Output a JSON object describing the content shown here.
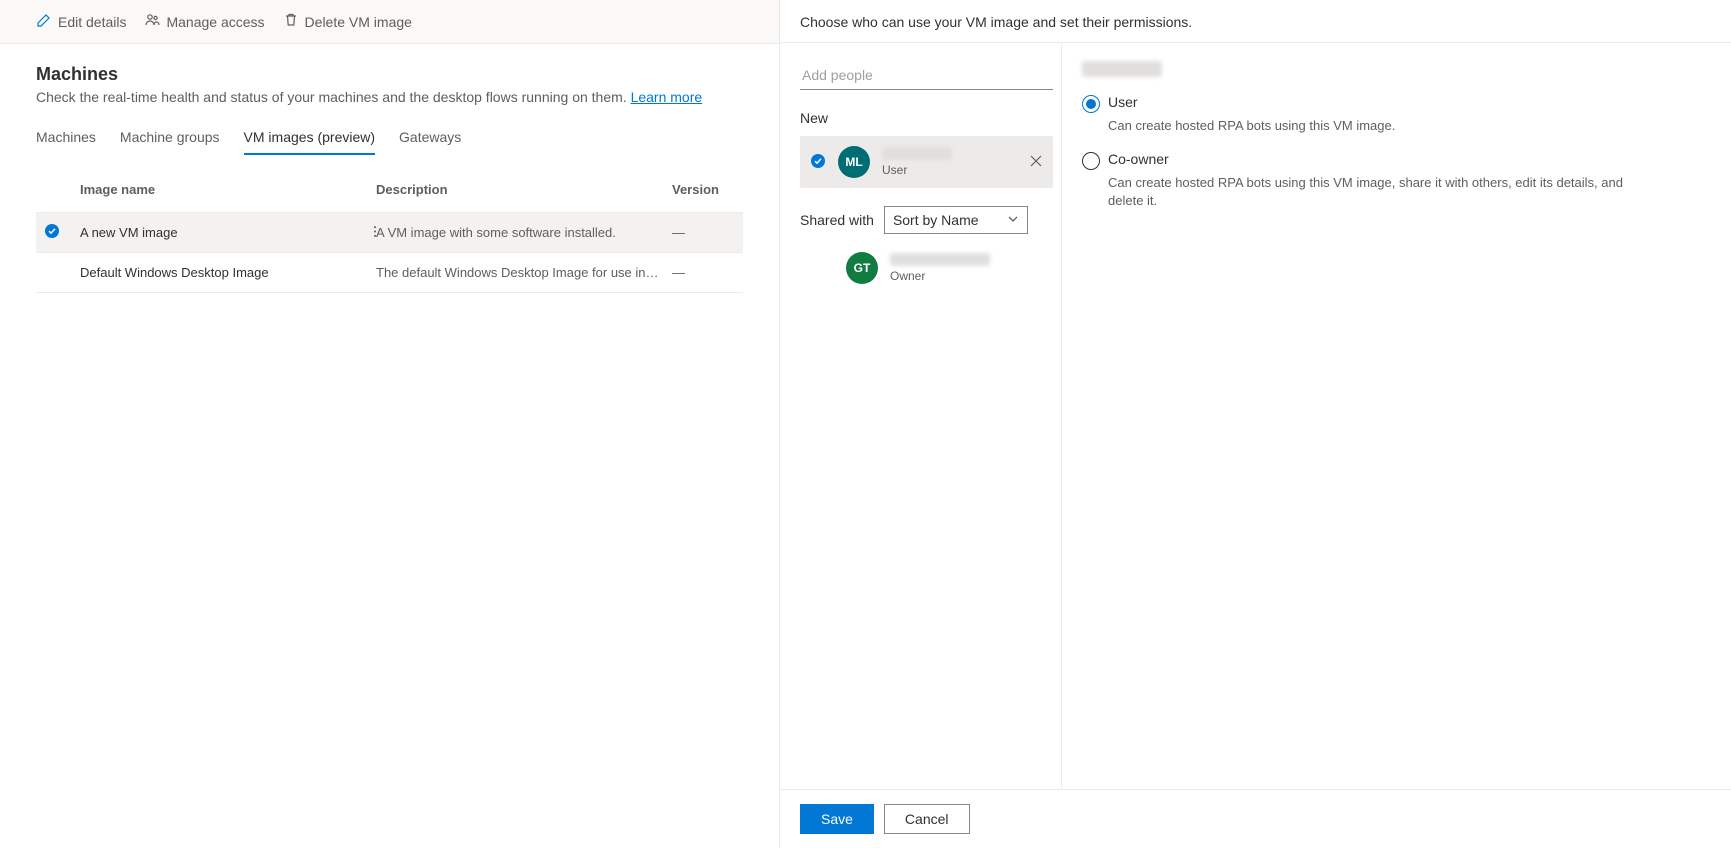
{
  "toolbar": {
    "edit": "Edit details",
    "manage": "Manage access",
    "delete": "Delete VM image"
  },
  "page": {
    "title": "Machines",
    "subtitle_a": "Check the real-time health and status of your machines and the desktop flows running on them. ",
    "learn_more": "Learn more"
  },
  "tabs": {
    "machines": "Machines",
    "groups": "Machine groups",
    "vm": "VM images (preview)",
    "gateways": "Gateways"
  },
  "table": {
    "headers": {
      "name": "Image name",
      "desc": "Description",
      "version": "Version"
    },
    "rows": [
      {
        "selected": true,
        "name": "A new VM image",
        "desc": "A VM image with some software installed.",
        "version": "—"
      },
      {
        "selected": false,
        "name": "Default Windows Desktop Image",
        "desc": "The default Windows Desktop Image for use in the Product ...",
        "version": "—"
      }
    ]
  },
  "panel": {
    "header": "Choose who can use your VM image and set their permissions.",
    "add_placeholder": "Add people",
    "new_label": "New",
    "new_person": {
      "initials": "ML",
      "role": "User"
    },
    "shared_label": "Shared with",
    "sort_label": "Sort by Name",
    "owner": {
      "initials": "GT",
      "role": "Owner"
    },
    "perm": {
      "user_label": "User",
      "user_desc": "Can create hosted RPA bots using this VM image.",
      "coowner_label": "Co-owner",
      "coowner_desc": "Can create hosted RPA bots using this VM image, share it with others, edit its details, and delete it."
    },
    "save": "Save",
    "cancel": "Cancel"
  }
}
